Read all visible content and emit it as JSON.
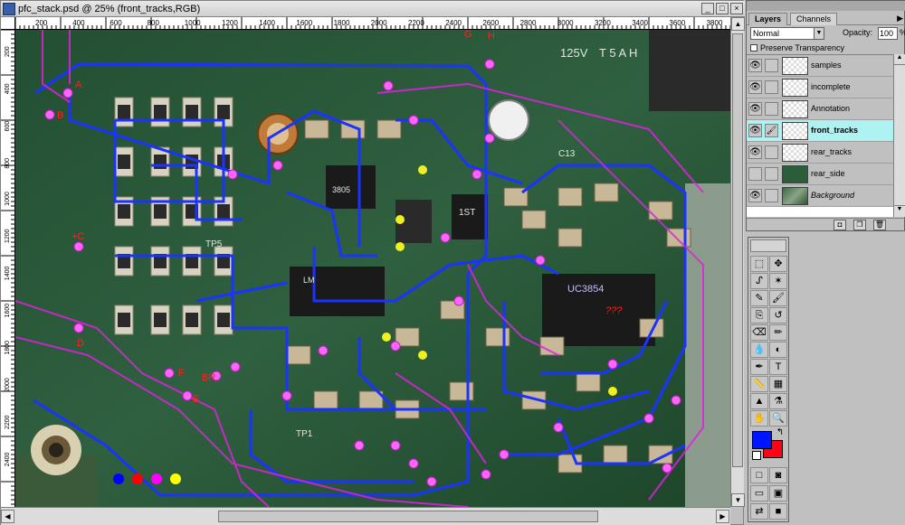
{
  "window": {
    "title": "pfc_stack.psd @ 25% (front_tracks,RGB)",
    "minimize": "_",
    "maximize": "□",
    "close": "×"
  },
  "rulers": {
    "horizontal_ticks": [
      "200",
      "400",
      "600",
      "800",
      "1000",
      "1200",
      "1400",
      "1600",
      "1800",
      "2000",
      "2200",
      "2400",
      "2600",
      "2800",
      "3000",
      "3200",
      "3400",
      "3600",
      "3800"
    ],
    "vertical_ticks": [
      "200",
      "400",
      "600",
      "800",
      "1000",
      "1200",
      "1400",
      "1600",
      "1800",
      "2000",
      "2200",
      "2400"
    ]
  },
  "board_labels": {
    "A": "A",
    "B": "B",
    "C": "+C",
    "D": "D",
    "E": "E",
    "F": "F",
    "Bt": "BR",
    "G": "G",
    "H": "H",
    "Ann": "???",
    "silk_1": "125V",
    "silk_2": "T 5 A H",
    "silk_3": "TP5",
    "silk_4": "TP1",
    "silk_5": "UC3854",
    "silk_6": "1ST",
    "silk_7": "3805",
    "silk_8": "LM",
    "silk_9": "C13"
  },
  "color_dots": [
    "#0000ff",
    "#ff0000",
    "#ff00ff",
    "#ffff00"
  ],
  "layers_palette": {
    "tab_layers": "Layers",
    "tab_channels": "Channels",
    "blend_mode": "Normal",
    "opacity_label": "Opacity:",
    "opacity_value": "100",
    "opacity_unit": "%",
    "preserve_transparency": "Preserve Transparency",
    "layers": [
      {
        "name": "samples",
        "visible": true
      },
      {
        "name": "incomplete",
        "visible": true
      },
      {
        "name": "Annotation",
        "visible": true
      },
      {
        "name": "front_tracks",
        "visible": true,
        "selected": true
      },
      {
        "name": "rear_tracks",
        "visible": true
      },
      {
        "name": "rear_side",
        "visible": false
      },
      {
        "name": "Background",
        "visible": true
      }
    ]
  },
  "toolbox": {
    "tools": [
      "marquee",
      "move",
      "lasso",
      "magic-wand",
      "airbrush",
      "paintbrush",
      "rubber-stamp",
      "history-brush",
      "eraser",
      "pencil",
      "blur",
      "dodge",
      "pen",
      "type",
      "measure",
      "gradient",
      "paint-bucket",
      "eyedropper",
      "hand",
      "zoom"
    ],
    "foreground_color": "#0015ff",
    "background_color": "#ff0015"
  }
}
